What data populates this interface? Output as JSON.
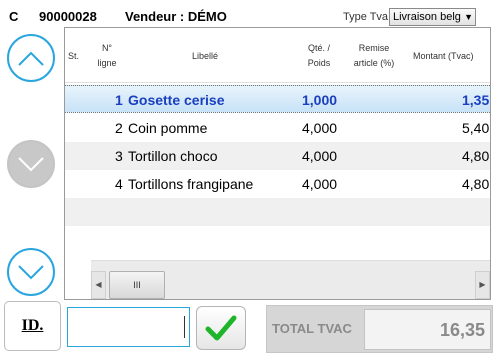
{
  "header": {
    "c_label": "C",
    "ticket_number": "90000028",
    "vendeur": "Vendeur : DÉMO",
    "type_tva_label": "Type Tva",
    "type_tva_value": "Livraison belg"
  },
  "grid": {
    "columns": {
      "st": "St.",
      "ligne_1": "N°",
      "ligne_2": "ligne",
      "libelle": "Libellé",
      "qte_1": "Qté. /",
      "qte_2": "Poids",
      "remise_1": "Remise",
      "remise_2": "article (%)",
      "montant": "Montant (Tvac)"
    },
    "rows": [
      {
        "num": "1",
        "libelle": "Gosette cerise",
        "qte": "1,000",
        "montant": "1,35"
      },
      {
        "num": "2",
        "libelle": "Coin pomme",
        "qte": "4,000",
        "montant": "5,40"
      },
      {
        "num": "3",
        "libelle": "Tortillon choco",
        "qte": "4,000",
        "montant": "4,80"
      },
      {
        "num": "4",
        "libelle": "Tortillons frangipane",
        "qte": "4,000",
        "montant": "4,80"
      }
    ],
    "scroll_thumb": "III"
  },
  "footer": {
    "id_button": "ID.",
    "id_input_value": "",
    "total_label": "TOTAL TVAC",
    "total_value": "16,35"
  },
  "colors": {
    "accent": "#2aa6de",
    "selected_text": "#1a3fbf",
    "ok_check": "#1fb52a"
  }
}
